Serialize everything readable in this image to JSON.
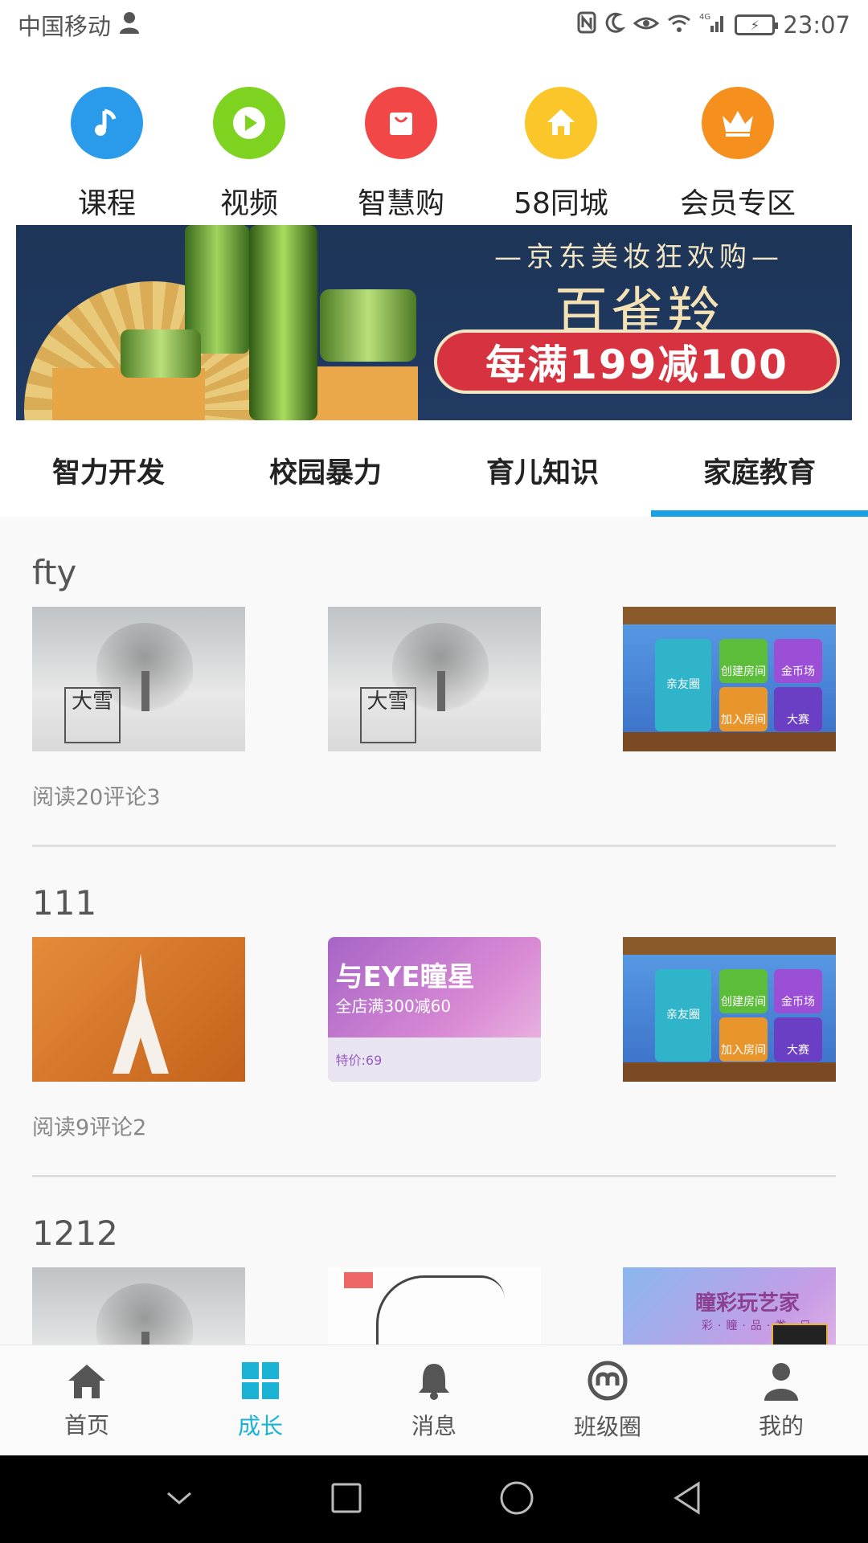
{
  "status_bar": {
    "carrier": "中国移动",
    "network": "4G",
    "time": "23:07"
  },
  "quick_categories": [
    {
      "label": "课程",
      "icon": "music-note-icon",
      "color": "#2a9bea"
    },
    {
      "label": "视频",
      "icon": "play-icon",
      "color": "#7ed321"
    },
    {
      "label": "智慧购",
      "icon": "shopping-bag-icon",
      "color": "#f24747"
    },
    {
      "label": "58同城",
      "icon": "home-icon",
      "color": "#fbc62a"
    },
    {
      "label": "会员专区",
      "icon": "crown-icon",
      "color": "#f5901f"
    }
  ],
  "banner": {
    "subtitle": "—京东美妆狂欢购—",
    "title": "百雀羚",
    "promo": "每满199减100"
  },
  "tabs": [
    {
      "label": "智力开发",
      "active": false
    },
    {
      "label": "校园暴力",
      "active": false
    },
    {
      "label": "育儿知识",
      "active": false
    },
    {
      "label": "家庭教育",
      "active": true
    }
  ],
  "posts": [
    {
      "title": "fty",
      "stats": "阅读20评论3",
      "thumbs": [
        "snow-tree-image",
        "snow-tree-image",
        "mahjong-game-image"
      ]
    },
    {
      "title": "111",
      "stats": "阅读9评论2",
      "thumbs": [
        "eiffel-tower-image",
        "eye-contact-lens-ad-image",
        "mahjong-game-image"
      ]
    },
    {
      "title": "1212",
      "stats": "",
      "thumbs": [
        "snow-tree-image",
        "sketch-girl-image",
        "contact-lens-promo-image"
      ]
    }
  ],
  "thumb_text": {
    "snow_seal": "大雪",
    "eye_title": "与EYE瞳星",
    "eye_sub": "全店满300减60",
    "eye_price": "特价:69",
    "game_tiles": [
      "亲友圈",
      "创建房间",
      "金币场",
      "加入房间",
      "大赛"
    ],
    "promo_title": "瞳彩玩艺家",
    "promo_sub": "彩·瞳·品·类·日"
  },
  "bottom_nav": [
    {
      "label": "首页",
      "icon": "home-icon",
      "active": false
    },
    {
      "label": "成长",
      "icon": "grid-icon",
      "active": true
    },
    {
      "label": "消息",
      "icon": "bell-icon",
      "active": false
    },
    {
      "label": "班级圈",
      "icon": "class-circle-icon",
      "active": false
    },
    {
      "label": "我的",
      "icon": "user-icon",
      "active": false
    }
  ],
  "colors": {
    "accent": "#18a0e5",
    "nav_active": "#1ab3d6"
  }
}
